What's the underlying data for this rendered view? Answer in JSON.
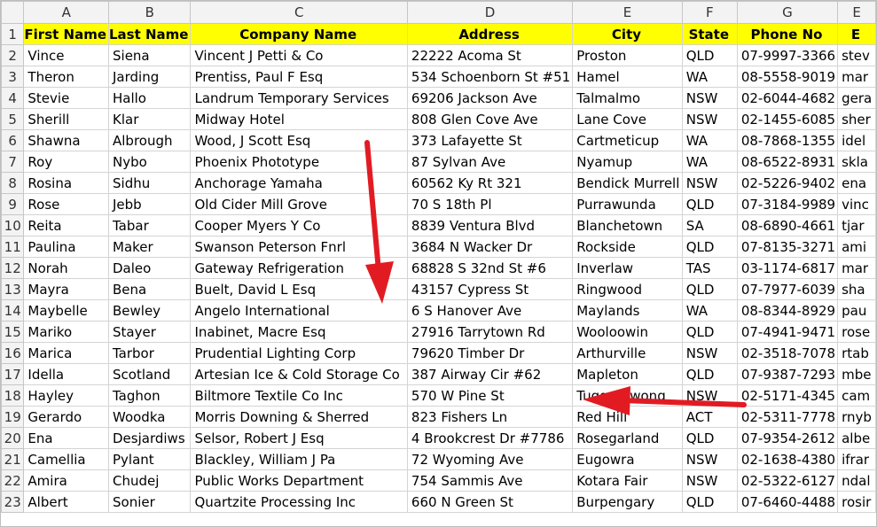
{
  "columns": [
    "A",
    "B",
    "C",
    "D",
    "E",
    "F",
    "G",
    "E"
  ],
  "headers": [
    "First Name",
    "Last Name",
    "Company Name",
    "Address",
    "City",
    "State",
    "Phone No",
    "E"
  ],
  "rows": [
    {
      "num": "2",
      "cells": [
        "Vince",
        "Siena",
        "Vincent J Petti & Co",
        "22222 Acoma St",
        "Proston",
        "QLD",
        "07-9997-3366",
        "stev"
      ]
    },
    {
      "num": "3",
      "cells": [
        "Theron",
        "Jarding",
        "Prentiss, Paul F Esq",
        "534 Schoenborn St #51",
        "Hamel",
        "WA",
        "08-5558-9019",
        "mar"
      ]
    },
    {
      "num": "4",
      "cells": [
        "Stevie",
        "Hallo",
        "Landrum Temporary Services",
        "69206 Jackson Ave",
        "Talmalmo",
        "NSW",
        "02-6044-4682",
        "gera"
      ]
    },
    {
      "num": "5",
      "cells": [
        "Sherill",
        "Klar",
        "Midway Hotel",
        "808 Glen Cove Ave",
        "Lane Cove",
        "NSW",
        "02-1455-6085",
        "sher"
      ]
    },
    {
      "num": "6",
      "cells": [
        "Shawna",
        "Albrough",
        "Wood, J Scott Esq",
        "373 Lafayette St",
        "Cartmeticup",
        "WA",
        "08-7868-1355",
        "idel"
      ]
    },
    {
      "num": "7",
      "cells": [
        "Roy",
        "Nybo",
        "Phoenix Phototype",
        "87 Sylvan Ave",
        "Nyamup",
        "WA",
        "08-6522-8931",
        "skla"
      ]
    },
    {
      "num": "8",
      "cells": [
        "Rosina",
        "Sidhu",
        "Anchorage Yamaha",
        "60562 Ky Rt 321",
        "Bendick Murrell",
        "NSW",
        "02-5226-9402",
        "ena"
      ]
    },
    {
      "num": "9",
      "cells": [
        "Rose",
        "Jebb",
        "Old Cider Mill Grove",
        "70 S 18th Pl",
        "Purrawunda",
        "QLD",
        "07-3184-9989",
        "vinc"
      ]
    },
    {
      "num": "10",
      "cells": [
        "Reita",
        "Tabar",
        "Cooper Myers Y Co",
        "8839 Ventura Blvd",
        "Blanchetown",
        "SA",
        "08-6890-4661",
        "tjar"
      ]
    },
    {
      "num": "11",
      "cells": [
        "Paulina",
        "Maker",
        "Swanson Peterson Fnrl",
        "3684 N Wacker Dr",
        "Rockside",
        "QLD",
        "07-8135-3271",
        "ami"
      ]
    },
    {
      "num": "12",
      "cells": [
        "Norah",
        "Daleo",
        "Gateway Refrigeration",
        "68828 S 32nd St #6",
        "Inverlaw",
        "TAS",
        "03-1174-6817",
        "mar"
      ]
    },
    {
      "num": "13",
      "cells": [
        "Mayra",
        "Bena",
        "Buelt, David L Esq",
        "43157 Cypress St",
        "Ringwood",
        "QLD",
        "07-7977-6039",
        "sha"
      ]
    },
    {
      "num": "14",
      "cells": [
        "Maybelle",
        "Bewley",
        "Angelo International",
        "6 S Hanover Ave",
        "Maylands",
        "WA",
        "08-8344-8929",
        "pau"
      ]
    },
    {
      "num": "15",
      "cells": [
        "Mariko",
        "Stayer",
        "Inabinet, Macre Esq",
        "27916 Tarrytown Rd",
        "Wooloowin",
        "QLD",
        "07-4941-9471",
        "rose"
      ]
    },
    {
      "num": "16",
      "cells": [
        "Marica",
        "Tarbor",
        "Prudential Lighting Corp",
        "79620 Timber Dr",
        "Arthurville",
        "NSW",
        "02-3518-7078",
        "rtab"
      ]
    },
    {
      "num": "17",
      "cells": [
        "Idella",
        "Scotland",
        "Artesian Ice & Cold Storage Co",
        "387 Airway Cir #62",
        "Mapleton",
        "QLD",
        "07-9387-7293",
        "mbe"
      ]
    },
    {
      "num": "18",
      "cells": [
        "Hayley",
        "Taghon",
        "Biltmore Textile Co Inc",
        "570 W Pine St",
        "Tuggerawong",
        "NSW",
        "02-5171-4345",
        "cam"
      ]
    },
    {
      "num": "19",
      "cells": [
        "Gerardo",
        "Woodka",
        "Morris Downing & Sherred",
        "823 Fishers Ln",
        "Red Hill",
        "ACT",
        "02-5311-7778",
        "rnyb"
      ]
    },
    {
      "num": "20",
      "cells": [
        "Ena",
        "Desjardiws",
        "Selsor, Robert J Esq",
        "4 Brookcrest Dr #7786",
        "Rosegarland",
        "QLD",
        "07-9354-2612",
        "albe"
      ]
    },
    {
      "num": "21",
      "cells": [
        "Camellia",
        "Pylant",
        "Blackley, William J Pa",
        "72 Wyoming Ave",
        "Eugowra",
        "NSW",
        "02-1638-4380",
        "ifrar"
      ]
    },
    {
      "num": "22",
      "cells": [
        "Amira",
        "Chudej",
        "Public Works Department",
        "754 Sammis Ave",
        "Kotara Fair",
        "NSW",
        "02-5322-6127",
        "ndal"
      ]
    },
    {
      "num": "23",
      "cells": [
        "Albert",
        "Sonier",
        "Quartzite Processing Inc",
        "660 N Green St",
        "Burpengary",
        "QLD",
        "07-6460-4488",
        "rosir"
      ]
    }
  ],
  "colors": {
    "header_fill": "#ffff00",
    "arrow": "#e21b23"
  }
}
